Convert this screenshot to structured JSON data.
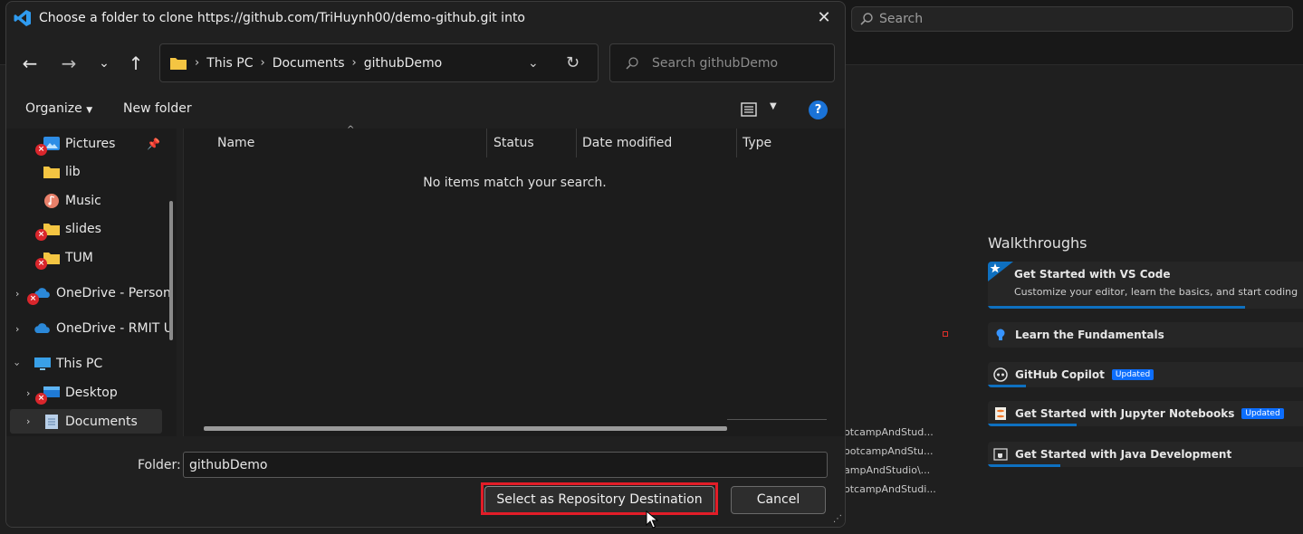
{
  "vscode": {
    "search_label": "Search",
    "recent_paths": [
      "otcampAndStud...",
      "ootcampAndStu...",
      "ampAndStudio\\...",
      "otcampAndStudi..."
    ],
    "walkthroughs": {
      "title": "Walkthroughs",
      "items": [
        {
          "title": "Get Started with VS Code",
          "description": "Customize your editor, learn the basics, and start coding",
          "badge": "",
          "icon": "star-icon",
          "progress": 0.85
        },
        {
          "title": "Learn the Fundamentals",
          "badge": "",
          "icon": "lightbulb-icon",
          "progress": 0
        },
        {
          "title": "GitHub Copilot",
          "badge": "Updated",
          "icon": "copilot-icon",
          "progress": 0.12
        },
        {
          "title": "Get Started with Jupyter Notebooks",
          "badge": "Updated",
          "icon": "jupyter-icon",
          "progress": 0.28
        },
        {
          "title": "Get Started with Java Development",
          "badge": "",
          "icon": "java-icon",
          "progress": 0.23
        }
      ]
    }
  },
  "dialog": {
    "title": "Choose a folder to clone https://github.com/TriHuynh00/demo-github.git into",
    "breadcrumb": [
      "This PC",
      "Documents",
      "githubDemo"
    ],
    "search_placeholder": "Search githubDemo",
    "commands": {
      "organize": "Organize",
      "new_folder": "New folder"
    },
    "nav_items": [
      {
        "label": "Pictures",
        "icon": "pictures-icon",
        "error": true,
        "pinned": true
      },
      {
        "label": "lib",
        "icon": "folder-icon",
        "error": false
      },
      {
        "label": "Music",
        "icon": "music-icon",
        "error": false
      },
      {
        "label": "slides",
        "icon": "folder-icon",
        "error": true
      },
      {
        "label": "TUM",
        "icon": "folder-icon",
        "error": true
      },
      {
        "label": "OneDrive - Person",
        "icon": "onedrive-icon",
        "error": true,
        "expandable": true
      },
      {
        "label": "OneDrive - RMIT U",
        "icon": "onedrive-icon",
        "error": false,
        "expandable": true
      },
      {
        "label": "This PC",
        "icon": "pc-icon",
        "error": false,
        "expanded": true
      },
      {
        "label": "Desktop",
        "icon": "desktop-icon",
        "error": true,
        "expandable": true
      },
      {
        "label": "Documents",
        "icon": "documents-icon",
        "error": false,
        "expandable": true,
        "selected": true
      }
    ],
    "columns": [
      "Name",
      "Status",
      "Date modified",
      "Type"
    ],
    "empty_message": "No items match your search.",
    "folder_label": "Folder:",
    "folder_value": "githubDemo",
    "primary_button": "Select as Repository Destination",
    "cancel_button": "Cancel"
  },
  "colors": {
    "accent": "#0e70c0",
    "highlight": "#e21d28",
    "badge": "#0d6efd"
  }
}
